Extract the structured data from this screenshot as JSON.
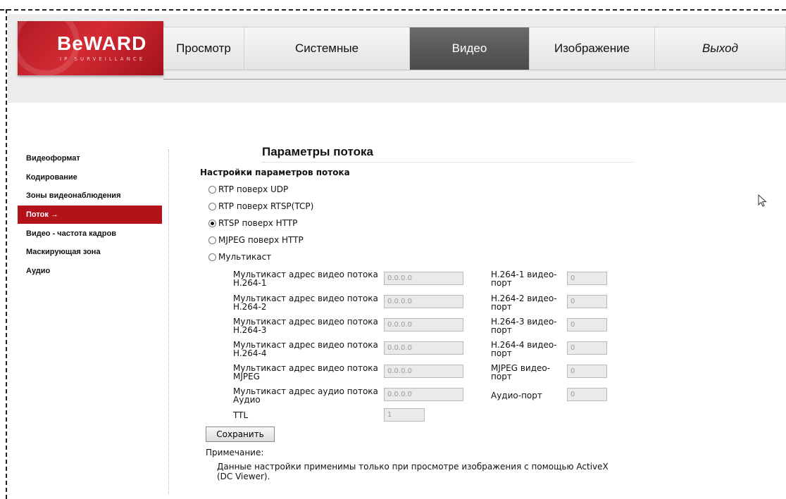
{
  "logo": {
    "main": "BeWARD",
    "sub": "IP SURVEILLANCE"
  },
  "nav": [
    {
      "label": "Просмотр",
      "active": false
    },
    {
      "label": "Системные",
      "active": false
    },
    {
      "label": "Видео",
      "active": true
    },
    {
      "label": "Изображение",
      "active": false
    },
    {
      "label": "Выход",
      "active": false
    }
  ],
  "sidebar": [
    {
      "label": "Видеоформат"
    },
    {
      "label": "Кодирование"
    },
    {
      "label": "Зоны видеонаблюдения"
    },
    {
      "label": "Поток →",
      "active": true
    },
    {
      "label": "Видео - частота кадров"
    },
    {
      "label": "Маскирующая зона"
    },
    {
      "label": "Аудио"
    }
  ],
  "main": {
    "title": "Параметры потока",
    "section_title": "Настройки параметров потока",
    "radios": [
      {
        "label": "RTP поверх UDP",
        "checked": false
      },
      {
        "label": "RTP поверх RTSP(TCP)",
        "checked": false
      },
      {
        "label": "RTSP поверх HTTP",
        "checked": true
      },
      {
        "label": "MJPEG поверх HTTP",
        "checked": false
      },
      {
        "label": "Мультикаст",
        "checked": false
      }
    ],
    "multicast": [
      {
        "addr_label": "Мультикаст адрес видео потока H.264-1",
        "addr_value": "0.0.0.0",
        "port_label": "H.264-1 видео-порт",
        "port_value": "0"
      },
      {
        "addr_label": "Мультикаст адрес видео потока H.264-2",
        "addr_value": "0.0.0.0",
        "port_label": "H.264-2 видео-порт",
        "port_value": "0"
      },
      {
        "addr_label": "Мультикаст адрес видео потока H.264-3",
        "addr_value": "0.0.0.0",
        "port_label": "H.264-3 видео-порт",
        "port_value": "0"
      },
      {
        "addr_label": "Мультикаст адрес видео потока H.264-4",
        "addr_value": "0.0.0.0",
        "port_label": "H.264-4 видео-порт",
        "port_value": "0"
      },
      {
        "addr_label": "Мультикаст адрес видео потока MJPEG",
        "addr_value": "0.0.0.0",
        "port_label": "MJPEG видео-порт",
        "port_value": "0"
      },
      {
        "addr_label": "Мультикаст адрес аудио потока Аудио",
        "addr_value": "0.0.0.0",
        "port_label": "Аудио-порт",
        "port_value": "0"
      }
    ],
    "ttl": {
      "label": "TTL",
      "value": "1"
    },
    "save_label": "Сохранить",
    "note_label": "Примечание:",
    "note_text": "Данные настройки применимы только при просмотре изображения с помощью ActiveX (DC Viewer)."
  },
  "colors": {
    "brand_red": "#b3121b",
    "active_tab": "#555555"
  }
}
